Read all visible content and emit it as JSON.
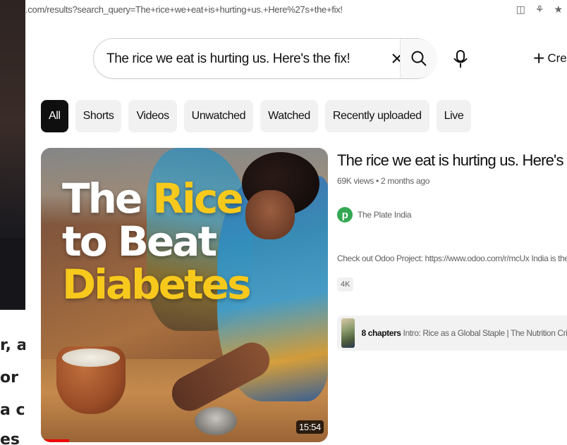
{
  "background_page": {
    "text_lines": [
      "r, a",
      "or",
      "a c",
      "es"
    ]
  },
  "browser": {
    "url": ".com/results?search_query=The+rice+we+eat+is+hurting+us.+Here%27s+the+fix!"
  },
  "header": {
    "search": {
      "value": "The rice we eat is hurting us. Here's the fix!",
      "placeholder": "Search"
    },
    "create_label": "Crea"
  },
  "filters": [
    {
      "label": "All",
      "active": true
    },
    {
      "label": "Shorts",
      "active": false
    },
    {
      "label": "Videos",
      "active": false
    },
    {
      "label": "Unwatched",
      "active": false
    },
    {
      "label": "Watched",
      "active": false
    },
    {
      "label": "Recently uploaded",
      "active": false
    },
    {
      "label": "Live",
      "active": false
    }
  ],
  "result": {
    "thumbnail": {
      "title_line1_white": "The ",
      "title_line1_yellow": "Rice",
      "title_line2": "to Beat",
      "title_line3": "Diabetes",
      "duration": "15:54"
    },
    "title": "The rice we eat is hurting us. Here's the fix!",
    "meta": "69K views • 2 months ago",
    "channel": {
      "avatar_letter": "p",
      "name": "The Plate India"
    },
    "description": "Check out Odoo Project: https://www.odoo.com/r/mcUx India is the world's",
    "badge": "4K",
    "chapters": {
      "count_label": "8 chapters",
      "text": "Intro: Rice as a Global Staple | The Nutrition Crisis"
    }
  },
  "colors": {
    "chip_active_bg": "#0f0f0f",
    "chip_bg": "#f1f1f1",
    "thumb_yellow": "#f7c91c",
    "channel_avatar": "#34a853"
  }
}
